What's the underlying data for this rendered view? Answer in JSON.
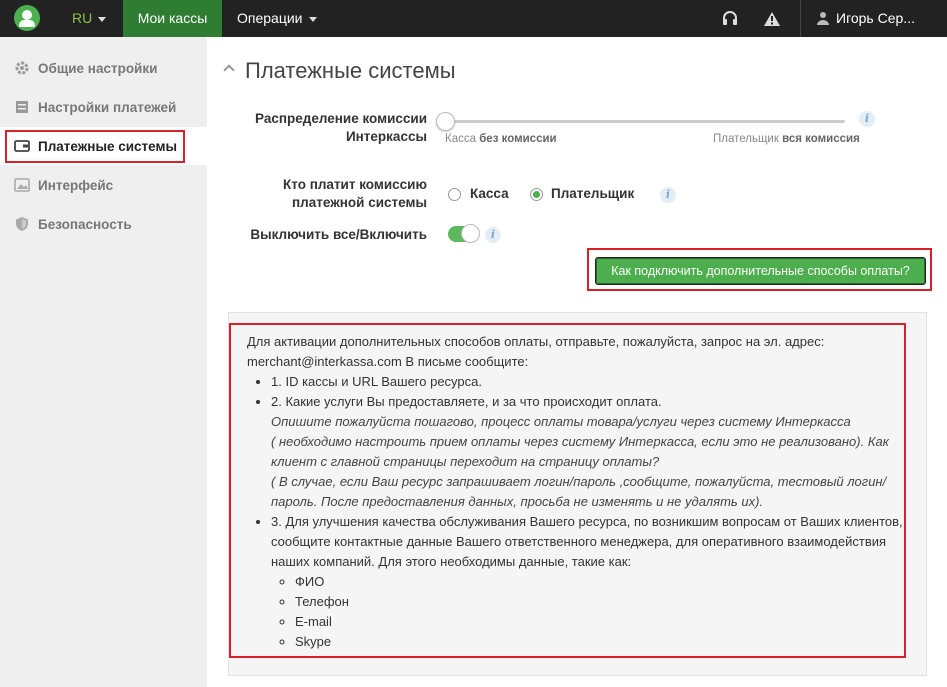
{
  "topbar": {
    "lang": "RU",
    "nav_active": "Мои кассы",
    "nav_ops": "Операции",
    "user": "Игорь Сер..."
  },
  "sidebar": {
    "items": [
      {
        "label": "Общие настройки",
        "icon": "gear-icon"
      },
      {
        "label": "Настройки платежей",
        "icon": "document-icon"
      },
      {
        "label": "Платежные системы",
        "icon": "wallet-icon"
      },
      {
        "label": "Интерфейс",
        "icon": "image-icon"
      },
      {
        "label": "Безопасность",
        "icon": "shield-icon"
      }
    ]
  },
  "main": {
    "title": "Платежные системы",
    "commission": {
      "label_line1": "Распределение комиссии",
      "label_line2": "Интеркассы",
      "left_prefix": "Касса",
      "left_value": "без комиссии",
      "right_prefix": "Плательщик",
      "right_value": "вся комиссия",
      "slider_level": 0
    },
    "payer": {
      "label_line1": "Кто платит комиссию",
      "label_line2": "платежной системы",
      "option_kassa": "Касса",
      "option_payer": "Плательщик",
      "selected": "Плательщик"
    },
    "toggle": {
      "label": "Выключить все/Включить",
      "on": true
    },
    "info_glyph": "i",
    "connect_button": "Как подключить дополнительные способы оплаты?",
    "info_panel": {
      "intro": "Для активации дополнительных способов оплаты, отправьте, пожалуйста, запрос на эл. адрес: merchant@interkassa.com В письме сообщите:",
      "item1": "1. ID кассы и URL Вашего ресурса.",
      "item2": "2. Какие услуги Вы предоставляете, и за что происходит оплата.",
      "item2_note1": "Опишите пожалуйста пошагово, процесс оплаты товара/услуги через систему Интеркасса",
      "item2_note2": "( необходимо настроить прием оплаты через систему Интеркасса, если это не реализовано). Как клиент с главной страницы переходит на страницу оплаты?",
      "item2_note3": "( В случае, если Ваш ресурс запрашивает логин/пароль ,сообщите, пожалуйста, тестовый логин/пароль. После предоставления данных, просьба не изменять и не удалять их).",
      "item3": "3. Для улучшения качества обслуживания Вашего ресурса, по возникшим вопросам от Ваших клиентов, сообщите контактные данные Вашего ответственного менеджера, для оперативного взаимодействия наших компаний. Для этого необходимы данные, такие как:",
      "subitems": [
        "ФИО",
        "Телефон",
        "E-mail",
        "Skype"
      ]
    }
  },
  "colors": {
    "accent": "#4caf50",
    "nav_active": "#2e7d32",
    "highlight": "#d9212b"
  }
}
